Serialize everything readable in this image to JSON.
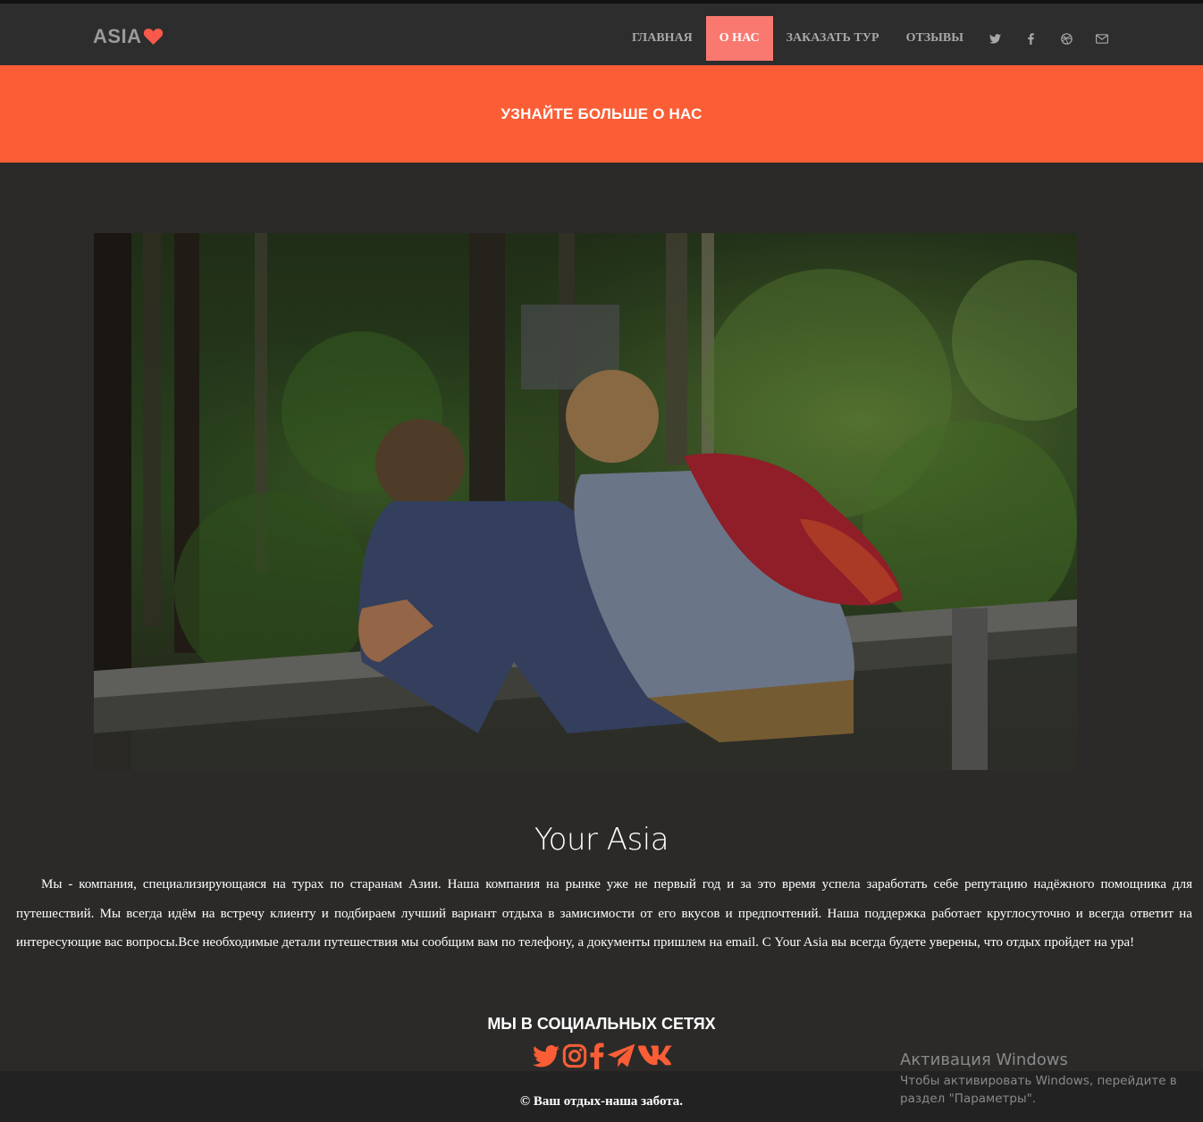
{
  "brand": {
    "name": "ASIA",
    "heart_color": "#f9594a"
  },
  "nav": {
    "items": [
      {
        "label": "ГЛАВНАЯ",
        "active": false
      },
      {
        "label": "О НАС",
        "active": true
      },
      {
        "label": "ЗАКАЗАТЬ ТУР",
        "active": false
      },
      {
        "label": "ОТЗЫВЫ",
        "active": false
      }
    ],
    "icons": [
      "twitter-icon",
      "facebook-icon",
      "dribbble-icon",
      "email-icon"
    ]
  },
  "banner": {
    "title": "УЗНАЙТЕ БОЛЬШЕ О НАС",
    "color": "#fb5e36"
  },
  "hero": {
    "alt": ""
  },
  "about": {
    "title": "Your Asia",
    "text": "Мы - компания, специализирующаяся на турах по старанам Азии. Наша компания на рынке уже не первый год и за это время успела заработать себе репутацию надёжного помощника для путешествий. Мы всегда идём на встречу клиенту и подбираем лучший вариант отдыха в замисимости от его вкусов и предпочтений. Наша поддержка работает круглосуточно и всегда ответит на интересующие вас вопросы.Все необходимые детали путешествия мы сообщим вам по телефону, а документы пришлем на email. С Your Asia вы всегда будете уверены, что отдых пройдет на ура!"
  },
  "social": {
    "title": "МЫ В СОЦИАЛЬНЫХ СЕТЯХ",
    "icons": [
      "twitter-icon",
      "instagram-icon",
      "facebook-icon",
      "telegram-icon",
      "vk-icon"
    ],
    "color": "#fb5e36"
  },
  "footer": {
    "text": "© Ваш отдых-наша забота."
  },
  "windows_watermark": {
    "title": "Активация Windows",
    "line1": "Чтобы активировать Windows, перейдите в",
    "line2": "раздел \"Параметры\"."
  }
}
